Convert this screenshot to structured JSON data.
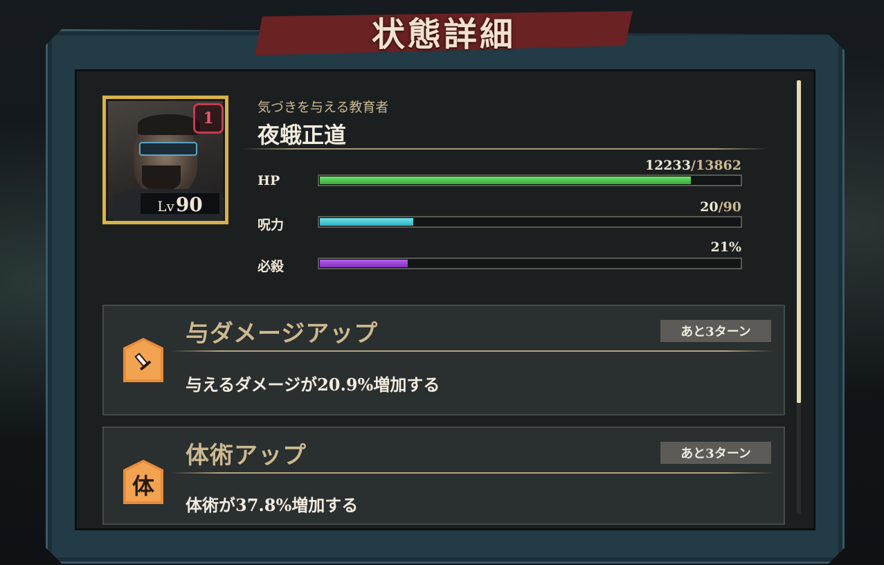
{
  "window": {
    "title": "状態詳細"
  },
  "character": {
    "subtitle": "気づきを与える教育者",
    "name": "夜蛾正道",
    "level_label": "Lv",
    "level": "90",
    "grade_badge": "1"
  },
  "stats": [
    {
      "label": "HP",
      "current": "12233",
      "max": "/13862",
      "fraction": 0.8825,
      "color": "#4cc84a"
    },
    {
      "label": "呪力",
      "current": "20",
      "max": "/90",
      "fraction": 0.2222,
      "color": "#3fc8d6"
    },
    {
      "label": "必殺",
      "current": "21%",
      "max": "",
      "fraction": 0.21,
      "color": "#9a44d6"
    }
  ],
  "effects": [
    {
      "title": "与ダメージアップ",
      "turns": "あと3ターン",
      "description": "与えるダメージが20.9%増加する",
      "icon": "sword-icon"
    },
    {
      "title": "体術アップ",
      "turns": "あと3ターン",
      "description": "体術が37.8%増加する",
      "icon": "taijutsu-icon",
      "icon_text": "体"
    }
  ],
  "colors": {
    "title_banner": "#6a2222",
    "frame": "#233b46",
    "panel": "#1b1f20",
    "card": "#2a2f30",
    "accent_gold": "#cdb98f",
    "icon_orange": "#e98c3a"
  }
}
